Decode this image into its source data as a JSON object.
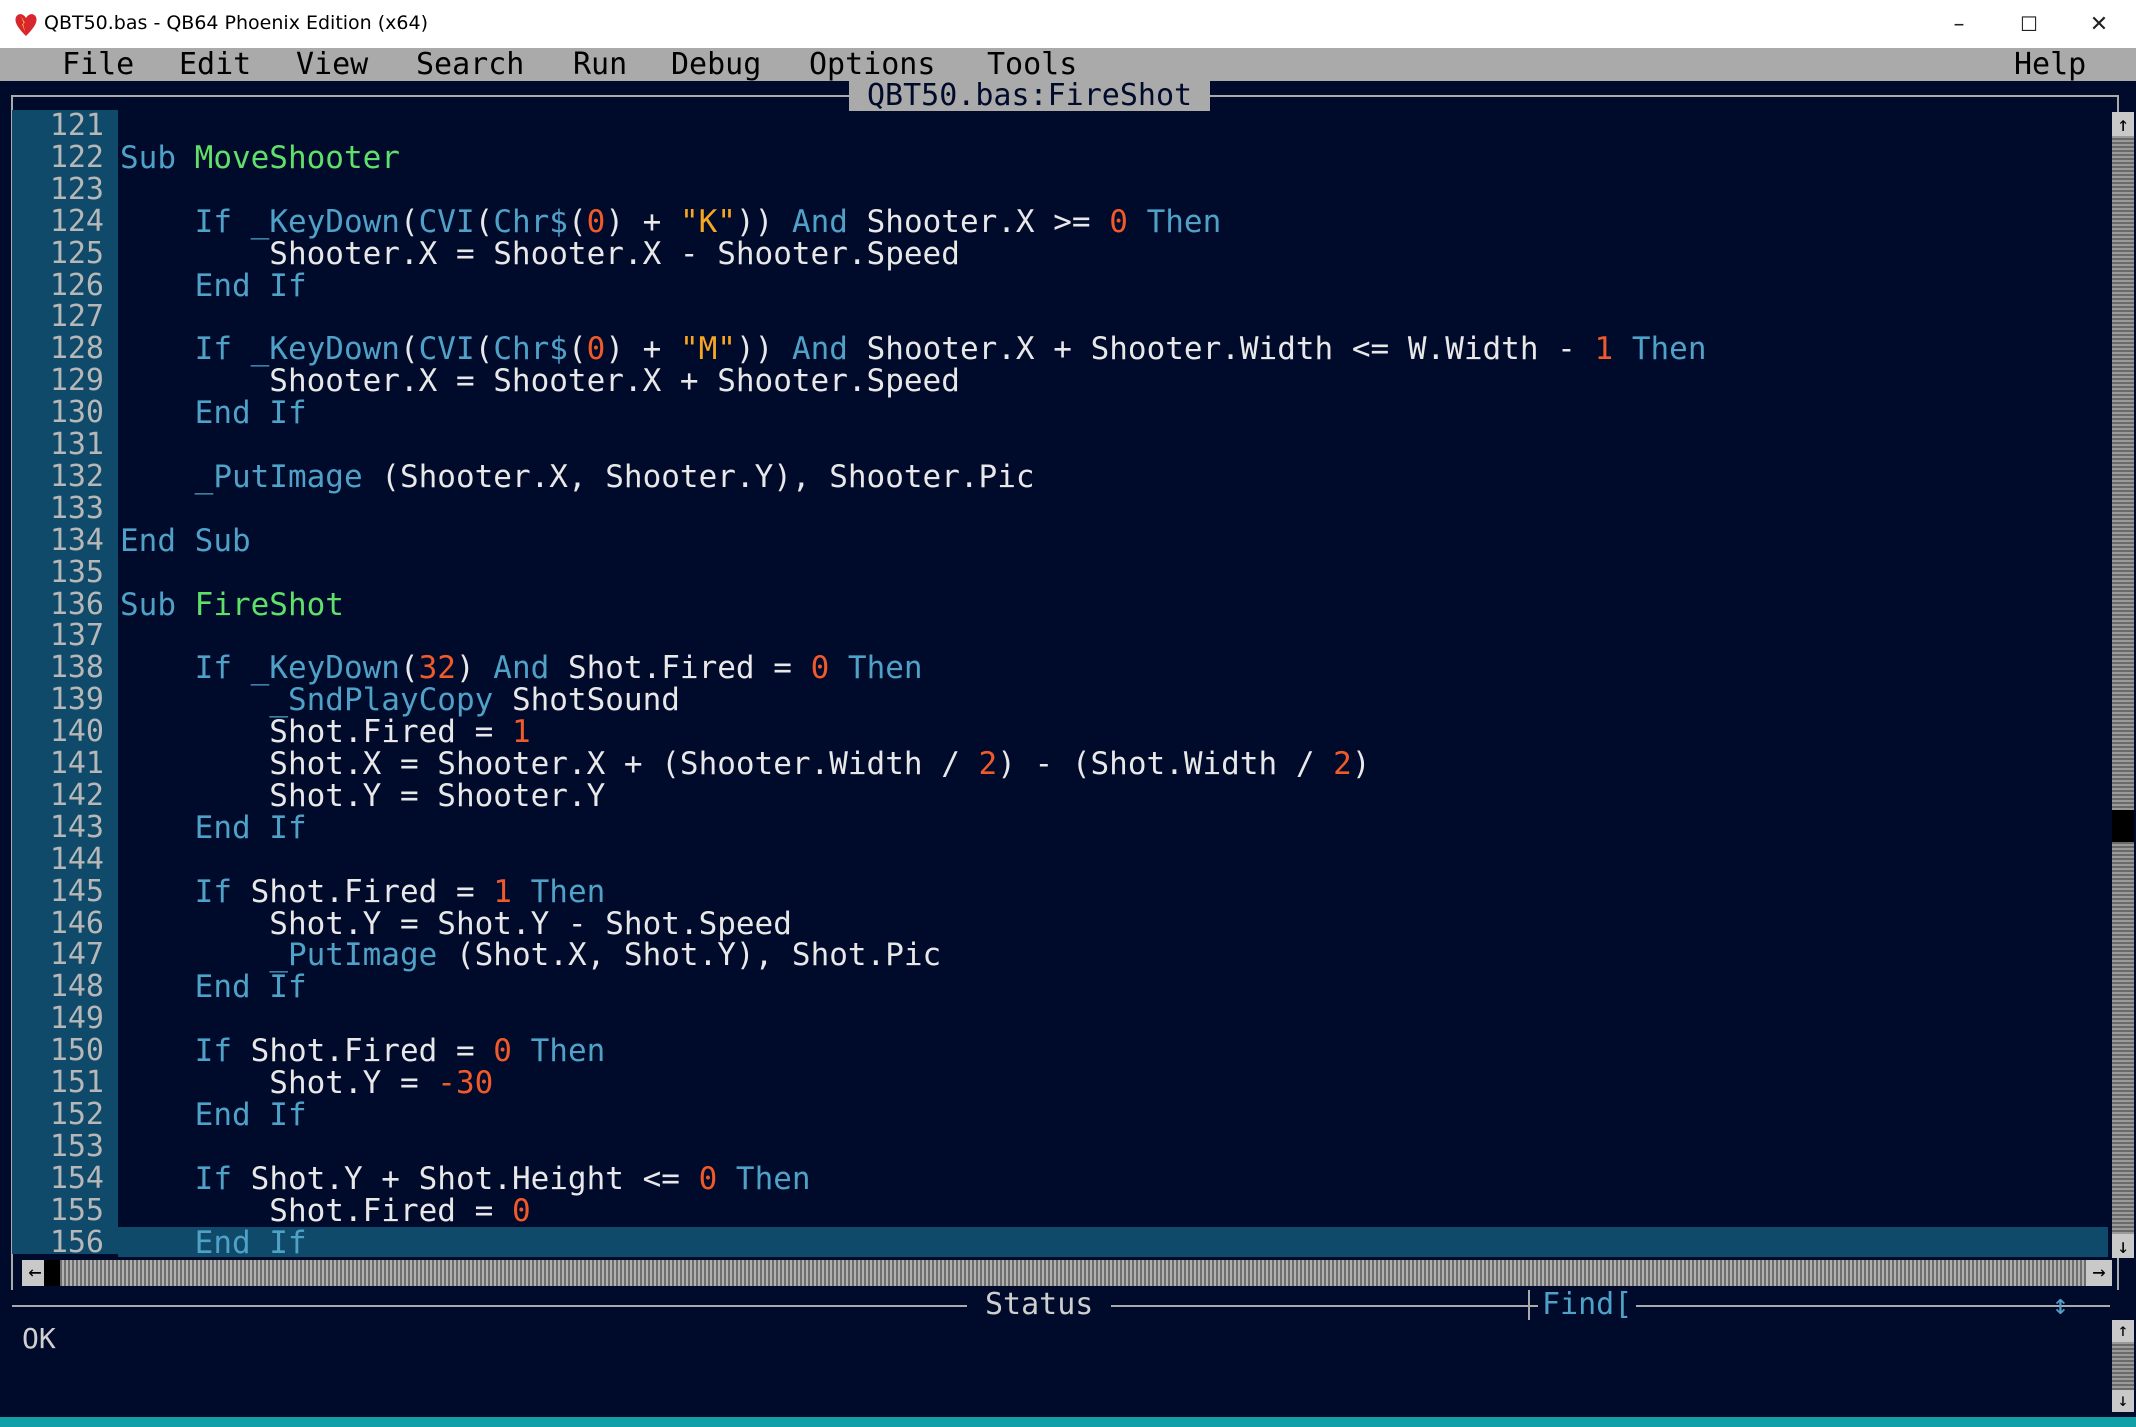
{
  "window": {
    "title": "QBT50.bas - QB64 Phoenix Edition (x64)",
    "minimize_glyph": "–",
    "maximize_glyph": "☐",
    "close_glyph": "✕"
  },
  "menu": {
    "items": [
      "File",
      "Edit",
      "View",
      "Search",
      "Run",
      "Debug",
      "Options",
      "Tools"
    ],
    "help": "Help"
  },
  "editor": {
    "title": "QBT50.bas:FireShot",
    "current_line": 156,
    "lines": [
      {
        "n": "121",
        "tokens": []
      },
      {
        "n": "122",
        "tokens": [
          [
            "kw",
            "Sub "
          ],
          [
            "sb",
            "MoveShooter"
          ]
        ]
      },
      {
        "n": "123",
        "tokens": []
      },
      {
        "n": "124",
        "tokens": [
          [
            "id",
            "    "
          ],
          [
            "kw",
            "If "
          ],
          [
            "fn",
            "_KeyDown"
          ],
          [
            "id",
            "("
          ],
          [
            "fn",
            "CVI"
          ],
          [
            "id",
            "("
          ],
          [
            "fn",
            "Chr$"
          ],
          [
            "id",
            "("
          ],
          [
            "nm",
            "0"
          ],
          [
            "id",
            ") + "
          ],
          [
            "st",
            "\"K\""
          ],
          [
            "id",
            ")) "
          ],
          [
            "kw",
            "And "
          ],
          [
            "id",
            "Shooter.X >= "
          ],
          [
            "nm",
            "0"
          ],
          [
            "kw",
            " Then"
          ]
        ]
      },
      {
        "n": "125",
        "tokens": [
          [
            "id",
            "        Shooter.X = Shooter.X - Shooter.Speed"
          ]
        ]
      },
      {
        "n": "126",
        "tokens": [
          [
            "kw",
            "    End If"
          ]
        ]
      },
      {
        "n": "127",
        "tokens": []
      },
      {
        "n": "128",
        "tokens": [
          [
            "id",
            "    "
          ],
          [
            "kw",
            "If "
          ],
          [
            "fn",
            "_KeyDown"
          ],
          [
            "id",
            "("
          ],
          [
            "fn",
            "CVI"
          ],
          [
            "id",
            "("
          ],
          [
            "fn",
            "Chr$"
          ],
          [
            "id",
            "("
          ],
          [
            "nm",
            "0"
          ],
          [
            "id",
            ") + "
          ],
          [
            "st",
            "\"M\""
          ],
          [
            "id",
            ")) "
          ],
          [
            "kw",
            "And "
          ],
          [
            "id",
            "Shooter.X + Shooter.Width <= W.Width - "
          ],
          [
            "nm",
            "1"
          ],
          [
            "kw",
            " Then"
          ]
        ]
      },
      {
        "n": "129",
        "tokens": [
          [
            "id",
            "        Shooter.X = Shooter.X + Shooter.Speed"
          ]
        ]
      },
      {
        "n": "130",
        "tokens": [
          [
            "kw",
            "    End If"
          ]
        ]
      },
      {
        "n": "131",
        "tokens": []
      },
      {
        "n": "132",
        "tokens": [
          [
            "id",
            "    "
          ],
          [
            "fn",
            "_PutImage"
          ],
          [
            "id",
            " (Shooter.X, Shooter.Y), Shooter.Pic"
          ]
        ]
      },
      {
        "n": "133",
        "tokens": []
      },
      {
        "n": "134",
        "tokens": [
          [
            "kw",
            "End Sub"
          ]
        ]
      },
      {
        "n": "135",
        "tokens": []
      },
      {
        "n": "136",
        "tokens": [
          [
            "kw",
            "Sub "
          ],
          [
            "sb",
            "FireShot"
          ]
        ]
      },
      {
        "n": "137",
        "tokens": []
      },
      {
        "n": "138",
        "tokens": [
          [
            "id",
            "    "
          ],
          [
            "kw",
            "If "
          ],
          [
            "fn",
            "_KeyDown"
          ],
          [
            "id",
            "("
          ],
          [
            "nm",
            "32"
          ],
          [
            "id",
            ") "
          ],
          [
            "kw",
            "And "
          ],
          [
            "id",
            "Shot.Fired = "
          ],
          [
            "nm",
            "0"
          ],
          [
            "kw",
            " Then"
          ]
        ]
      },
      {
        "n": "139",
        "tokens": [
          [
            "id",
            "        "
          ],
          [
            "fn",
            "_SndPlayCopy"
          ],
          [
            "id",
            " ShotSound"
          ]
        ]
      },
      {
        "n": "140",
        "tokens": [
          [
            "id",
            "        Shot.Fired = "
          ],
          [
            "nm",
            "1"
          ]
        ]
      },
      {
        "n": "141",
        "tokens": [
          [
            "id",
            "        Shot.X = Shooter.X + (Shooter.Width / "
          ],
          [
            "nm",
            "2"
          ],
          [
            "id",
            ") - (Shot.Width / "
          ],
          [
            "nm",
            "2"
          ],
          [
            "id",
            ")"
          ]
        ]
      },
      {
        "n": "142",
        "tokens": [
          [
            "id",
            "        Shot.Y = Shooter.Y"
          ]
        ]
      },
      {
        "n": "143",
        "tokens": [
          [
            "kw",
            "    End If"
          ]
        ]
      },
      {
        "n": "144",
        "tokens": []
      },
      {
        "n": "145",
        "tokens": [
          [
            "id",
            "    "
          ],
          [
            "kw",
            "If "
          ],
          [
            "id",
            "Shot.Fired = "
          ],
          [
            "nm",
            "1"
          ],
          [
            "kw",
            " Then"
          ]
        ]
      },
      {
        "n": "146",
        "tokens": [
          [
            "id",
            "        Shot.Y = Shot.Y - Shot.Speed"
          ]
        ]
      },
      {
        "n": "147",
        "tokens": [
          [
            "id",
            "        "
          ],
          [
            "fn",
            "_PutImage"
          ],
          [
            "id",
            " (Shot.X, Shot.Y), Shot.Pic"
          ]
        ]
      },
      {
        "n": "148",
        "tokens": [
          [
            "kw",
            "    End If"
          ]
        ]
      },
      {
        "n": "149",
        "tokens": []
      },
      {
        "n": "150",
        "tokens": [
          [
            "id",
            "    "
          ],
          [
            "kw",
            "If "
          ],
          [
            "id",
            "Shot.Fired = "
          ],
          [
            "nm",
            "0"
          ],
          [
            "kw",
            " Then"
          ]
        ]
      },
      {
        "n": "151",
        "tokens": [
          [
            "id",
            "        Shot.Y = "
          ],
          [
            "nm",
            "-30"
          ]
        ]
      },
      {
        "n": "152",
        "tokens": [
          [
            "kw",
            "    End If"
          ]
        ]
      },
      {
        "n": "153",
        "tokens": []
      },
      {
        "n": "154",
        "tokens": [
          [
            "id",
            "    "
          ],
          [
            "kw",
            "If "
          ],
          [
            "id",
            "Shot.Y + Shot.Height <= "
          ],
          [
            "nm",
            "0"
          ],
          [
            "kw",
            " Then"
          ]
        ]
      },
      {
        "n": "155",
        "tokens": [
          [
            "id",
            "        Shot.Fired = "
          ],
          [
            "nm",
            "0"
          ]
        ]
      },
      {
        "n": "156",
        "tokens": [
          [
            "kw",
            "    End If"
          ]
        ]
      }
    ]
  },
  "status": {
    "title": "Status",
    "find_label": "Find[",
    "text": "OK"
  },
  "colors": {
    "background": "#000a2a",
    "keyword": "#4fa1c8",
    "number": "#f05a2a",
    "string": "#f5a623",
    "sub_name": "#5ee06a",
    "gutter": "#0f4a6a",
    "menubar": "#aaaaaa"
  }
}
